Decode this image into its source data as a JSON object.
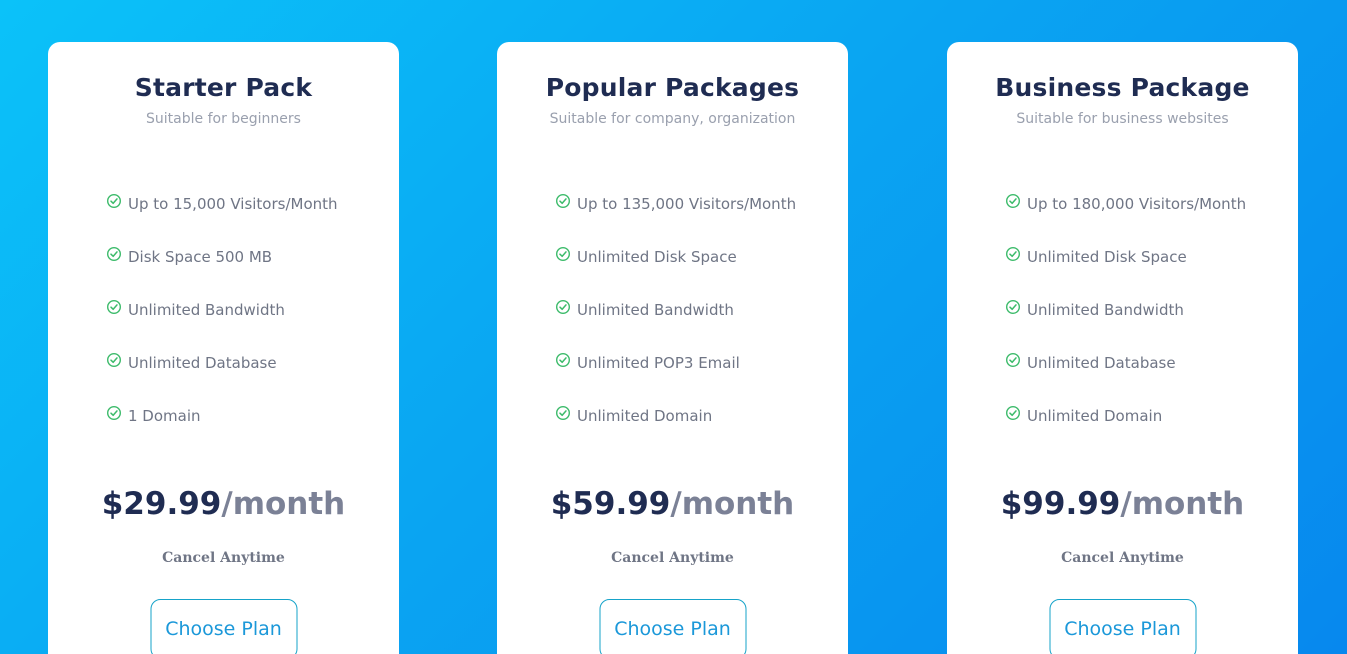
{
  "colors": {
    "background_start": "#0bc2f9",
    "background_end": "#0788ee",
    "title": "#1f2c52",
    "check": "#3dbb6b",
    "button_text": "#1b98d9",
    "button_border": "#16a3c9"
  },
  "plans": [
    {
      "title": "Starter Pack",
      "subtitle": "Suitable for beginners",
      "features": [
        "Up to 15,000 Visitors/Month",
        "Disk Space 500 MB",
        "Unlimited Bandwidth",
        "Unlimited Database",
        "1 Domain"
      ],
      "price": "$29.99",
      "period": "/month",
      "note": "Cancel Anytime",
      "button": "Choose Plan"
    },
    {
      "title": "Popular Packages",
      "subtitle": "Suitable for company, organization",
      "features": [
        "Up to 135,000 Visitors/Month",
        "Unlimited Disk Space",
        "Unlimited Bandwidth",
        "Unlimited POP3 Email",
        "Unlimited Domain"
      ],
      "price": "$59.99",
      "period": "/month",
      "note": "Cancel Anytime",
      "button": "Choose Plan"
    },
    {
      "title": "Business Package",
      "subtitle": "Suitable for business websites",
      "features": [
        "Up to 180,000 Visitors/Month",
        "Unlimited Disk Space",
        "Unlimited Bandwidth",
        "Unlimited Database",
        "Unlimited Domain"
      ],
      "price": "$99.99",
      "period": "/month",
      "note": "Cancel Anytime",
      "button": "Choose Plan"
    }
  ],
  "icons": {
    "feature_icon": "check-circle-icon"
  }
}
